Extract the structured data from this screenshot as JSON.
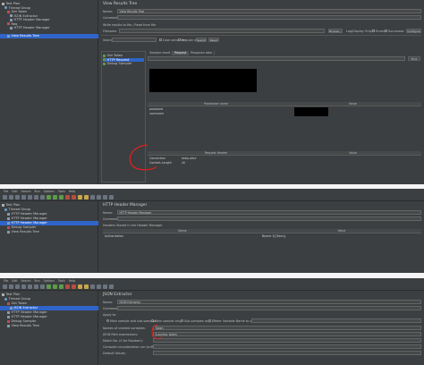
{
  "panel1": {
    "tree": [
      "Test Plan",
      "Thread Group",
      "Get Token",
      "JSON Extractor",
      "HTTP Header Manager",
      "Req",
      "HTTP Header Manager",
      "View Results Tree"
    ],
    "title": "View Results Tree",
    "name_label": "Name:",
    "name_value": "View Results Tree",
    "comments_label": "Comments:",
    "write_label": "Write results to file / Read from file",
    "filename_label": "Filename",
    "browse": "Browse...",
    "log_display": "Log/Display Only:",
    "errors": "Errors",
    "successes": "Successes",
    "configure": "Configure",
    "search_label": "Search:",
    "case_sensitive": "Case sensitive",
    "regular_exp": "Regular exp.",
    "search_btn": "Search",
    "reset_btn": "Reset",
    "sampler_tree": [
      "Get Token",
      "HTTP Request",
      "Debug Sampler"
    ],
    "tabs": [
      "Sampler result",
      "Request",
      "Response data"
    ],
    "find_btn": "Find",
    "params_header": [
      "Parameter name",
      "Value"
    ],
    "params": [
      {
        "name": "password",
        "value": ""
      },
      {
        "name": "username",
        "value": ""
      }
    ],
    "headers_header": [
      "Request Header",
      "Value"
    ],
    "headers": [
      {
        "name": "Connection",
        "value": "keep-alive"
      },
      {
        "name": "Content-Length",
        "value": "40"
      }
    ]
  },
  "panel2": {
    "tree": [
      "Test Plan",
      "Thread Group",
      "HTTP Header Manager",
      "HTTP Header Manager",
      "HTTP Header Manager",
      "Debug Sampler",
      "View Results Tree"
    ],
    "title": "HTTP Header Manager",
    "name_label": "Name:",
    "name_value": "HTTP Header Manager",
    "comments_label": "Comments:",
    "stored_label": "Headers Stored in the Header Manager",
    "headers_header": [
      "Name",
      "Value"
    ],
    "row_name": "Authorization",
    "row_value": "Bearer ${Token}"
  },
  "panel3": {
    "tree": [
      "Test Plan",
      "Thread Group",
      "Get Token",
      "JSON Extractor",
      "HTTP Header Manager",
      "HTTP Header Manager",
      "Debug Sampler",
      "View Results Tree"
    ],
    "title": "JSON Extractor",
    "name_label": "Name:",
    "name_value": "JSON Extractor",
    "comments_label": "Comments:",
    "apply_label": "Apply to:",
    "apply_options": [
      "Main sample and sub-samples",
      "Main sample only",
      "Sub-samples only",
      "JMeter Variable Name to use"
    ],
    "var_label": "Names of created variables:",
    "var_value": "Token",
    "json_label": "JSON Path expressions:",
    "json_value": "$.access_token",
    "match_label": "Match No. (0 for Random):",
    "concat_label": "Compute concatenation var (suffix _ALL):",
    "default_label": "Default Values:"
  },
  "menus": [
    "File",
    "Edit",
    "Search",
    "Run",
    "Options",
    "Tools",
    "Help"
  ]
}
